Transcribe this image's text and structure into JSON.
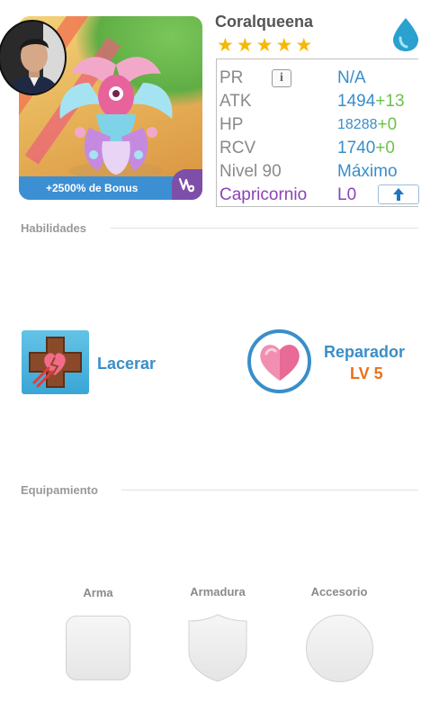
{
  "monster": {
    "name": "Coralqueena",
    "stars": 5,
    "bonus_text": "+2500% de Bonus",
    "element_icon": "water-drop-icon",
    "zodiac_icon": "capricorn-icon"
  },
  "stats": {
    "pr": {
      "label": "PR",
      "value": "N/A"
    },
    "atk": {
      "label": "ATK",
      "value": "1494",
      "plus": "+13"
    },
    "hp": {
      "label": "HP",
      "value": "18288",
      "plus": "+0"
    },
    "rcv": {
      "label": "RCV",
      "value": "1740",
      "plus": "+0"
    },
    "level": {
      "label": "Nivel 90",
      "value": "Máximo"
    },
    "sign": {
      "label": "Capricornio",
      "value": "L0"
    }
  },
  "sections": {
    "skills_title": "Habilidades",
    "equipment_title": "Equipamiento"
  },
  "skills": {
    "active": {
      "name": "Lacerar",
      "icon": "broken-heart-cross-icon"
    },
    "leader": {
      "name": "Reparador",
      "level": "LV 5",
      "icon": "heart-icon"
    }
  },
  "equipment": {
    "weapon_label": "Arma",
    "armor_label": "Armadura",
    "accessory_label": "Accesorio"
  },
  "colors": {
    "accent_blue": "#3a8ec9",
    "bonus_green": "#6cc24a",
    "zodiac_purple": "#8a45b5",
    "level_orange": "#e8711f",
    "star_gold": "#f6b800"
  }
}
